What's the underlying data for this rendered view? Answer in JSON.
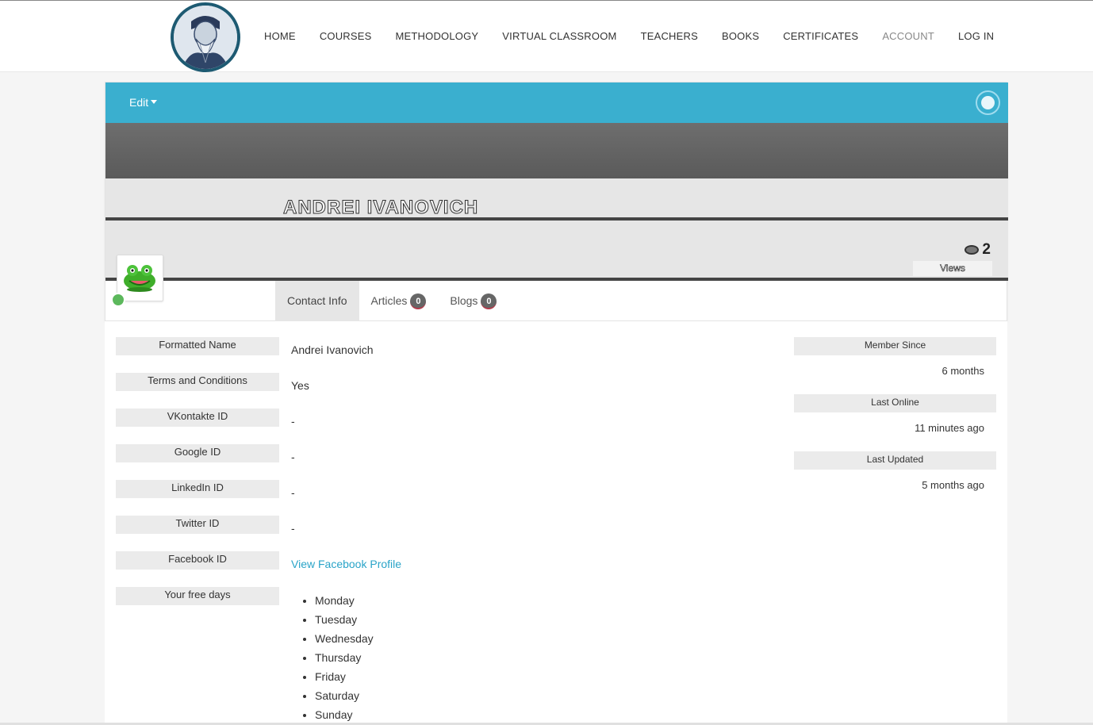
{
  "nav": {
    "items": [
      {
        "label": "HOME"
      },
      {
        "label": "COURSES"
      },
      {
        "label": "METHODOLOGY"
      },
      {
        "label": "VIRTUAL CLASSROOM"
      },
      {
        "label": "TEACHERS"
      },
      {
        "label": "BOOKS"
      },
      {
        "label": "CERTIFICATES"
      },
      {
        "label": "ACCOUNT"
      },
      {
        "label": "LOG IN"
      }
    ]
  },
  "toolbar": {
    "edit_label": "Edit"
  },
  "profile": {
    "name": "ANDREI IVANOVICH",
    "views_count": "2",
    "views_label": "Views"
  },
  "tabs": [
    {
      "label": "Contact Info"
    },
    {
      "label": "Articles",
      "count": "0"
    },
    {
      "label": "Blogs",
      "count": "0"
    }
  ],
  "fields": [
    {
      "label": "Formatted Name",
      "value": "Andrei Ivanovich"
    },
    {
      "label": "Terms and Conditions",
      "value": "Yes"
    },
    {
      "label": "VKontakte ID",
      "value": "-"
    },
    {
      "label": "Google ID",
      "value": "-"
    },
    {
      "label": "LinkedIn ID",
      "value": "-"
    },
    {
      "label": "Twitter ID",
      "value": "-"
    },
    {
      "label": "Facebook ID",
      "value": "View Facebook Profile"
    },
    {
      "label": "Your free days",
      "value": ""
    }
  ],
  "free_days": [
    "Monday",
    "Tuesday",
    "Wednesday",
    "Thursday",
    "Friday",
    "Saturday",
    "Sunday"
  ],
  "sidebar": [
    {
      "label": "Member Since",
      "value": "6 months"
    },
    {
      "label": "Last Online",
      "value": "11 minutes ago"
    },
    {
      "label": "Last Updated",
      "value": "5 months ago"
    }
  ],
  "colors": {
    "accent": "#3aafcf",
    "link": "#2aa4c8",
    "online": "#5cb85c"
  }
}
